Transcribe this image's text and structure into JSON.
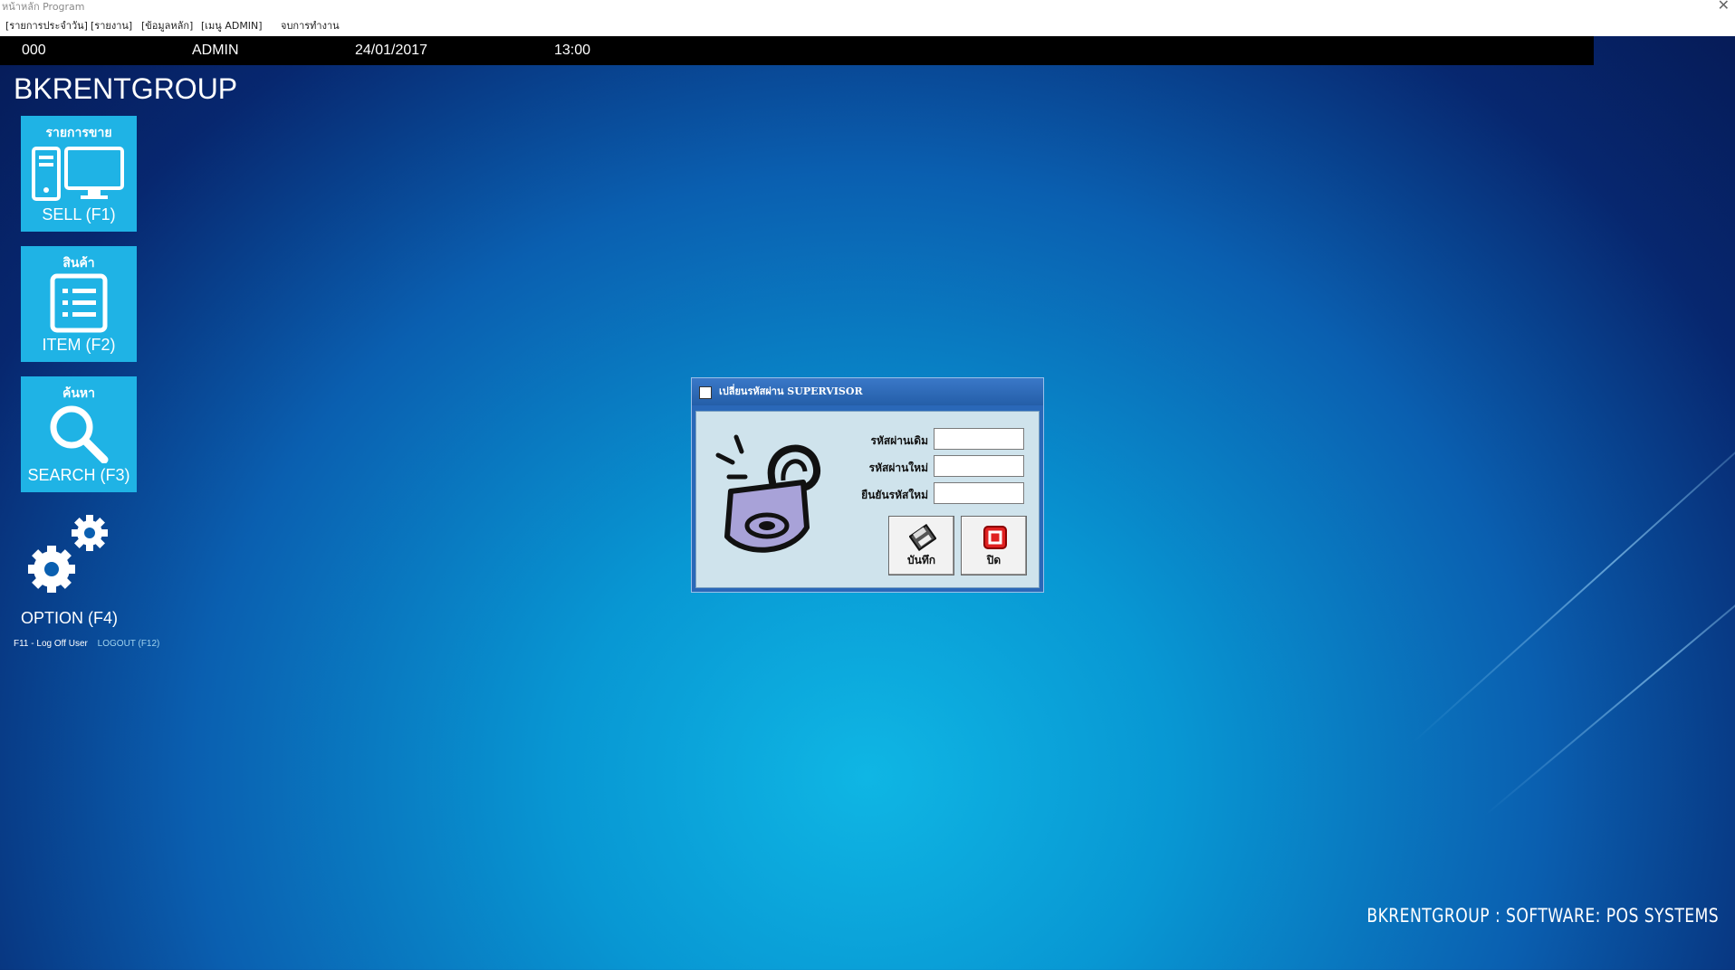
{
  "window": {
    "title": "หน้าหลัก Program",
    "close_glyph": "✕"
  },
  "menu": {
    "items": [
      {
        "label": "[รายการประจำวัน]"
      },
      {
        "label": "[รายงาน]"
      },
      {
        "label": "[ข้อมูลหลัก]"
      },
      {
        "label": "[เมนู ADMIN]"
      },
      {
        "label": "จบการทำงาน"
      }
    ]
  },
  "status": {
    "code": "000",
    "user": "ADMIN",
    "date": "24/01/2017",
    "time": "13:00"
  },
  "brand": "BKRENTGROUP",
  "tiles": [
    {
      "thai": "รายการขาย",
      "label": "SELL (F1)",
      "icon": "computer-icon"
    },
    {
      "thai": "สินค้า",
      "label": "ITEM (F2)",
      "icon": "list-icon"
    },
    {
      "thai": "ค้นหา",
      "label": "SEARCH (F3)",
      "icon": "search-icon"
    }
  ],
  "option": {
    "label": "OPTION (F4)",
    "icon": "gears-icon"
  },
  "links": {
    "logoff": "F11 - Log Off User",
    "logout": "LOGOUT (F12)"
  },
  "footer": "BKRENTGROUP : SOFTWARE: POS SYSTEMS",
  "dialog": {
    "title": "เปลี่ยนรหัสผ่าน SUPERVISOR",
    "fields": [
      {
        "label": "รหัสผ่านเดิม",
        "value": ""
      },
      {
        "label": "รหัสผ่านใหม่",
        "value": ""
      },
      {
        "label": "ยืนยันรหัสใหม่",
        "value": ""
      }
    ],
    "save_label": "บันทึก",
    "close_label": "ปิด"
  },
  "colors": {
    "tile": "#1fb3e5",
    "statusbar": "#000000",
    "close_button": "#e02020"
  }
}
